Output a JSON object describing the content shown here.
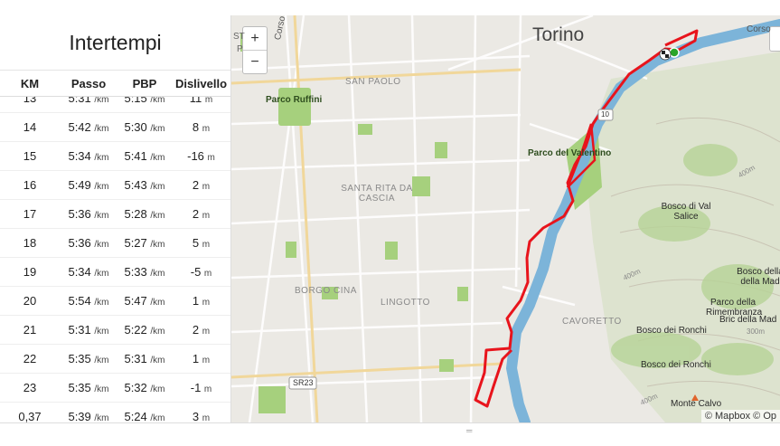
{
  "panel": {
    "title": "Intertempi",
    "columns": [
      "KM",
      "Passo",
      "PBP",
      "Dislivello"
    ],
    "rows": [
      {
        "km": "13",
        "pace": "5:31",
        "pace_unit": "/km",
        "pbp": "5:15",
        "pbp_unit": "/km",
        "elev": "11",
        "elev_unit": "m"
      },
      {
        "km": "14",
        "pace": "5:42",
        "pace_unit": "/km",
        "pbp": "5:30",
        "pbp_unit": "/km",
        "elev": "8",
        "elev_unit": "m"
      },
      {
        "km": "15",
        "pace": "5:34",
        "pace_unit": "/km",
        "pbp": "5:41",
        "pbp_unit": "/km",
        "elev": "-16",
        "elev_unit": "m"
      },
      {
        "km": "16",
        "pace": "5:49",
        "pace_unit": "/km",
        "pbp": "5:43",
        "pbp_unit": "/km",
        "elev": "2",
        "elev_unit": "m"
      },
      {
        "km": "17",
        "pace": "5:36",
        "pace_unit": "/km",
        "pbp": "5:28",
        "pbp_unit": "/km",
        "elev": "2",
        "elev_unit": "m"
      },
      {
        "km": "18",
        "pace": "5:36",
        "pace_unit": "/km",
        "pbp": "5:27",
        "pbp_unit": "/km",
        "elev": "5",
        "elev_unit": "m"
      },
      {
        "km": "19",
        "pace": "5:34",
        "pace_unit": "/km",
        "pbp": "5:33",
        "pbp_unit": "/km",
        "elev": "-5",
        "elev_unit": "m"
      },
      {
        "km": "20",
        "pace": "5:54",
        "pace_unit": "/km",
        "pbp": "5:47",
        "pbp_unit": "/km",
        "elev": "1",
        "elev_unit": "m"
      },
      {
        "km": "21",
        "pace": "5:31",
        "pace_unit": "/km",
        "pbp": "5:22",
        "pbp_unit": "/km",
        "elev": "2",
        "elev_unit": "m"
      },
      {
        "km": "22",
        "pace": "5:35",
        "pace_unit": "/km",
        "pbp": "5:31",
        "pbp_unit": "/km",
        "elev": "1",
        "elev_unit": "m"
      },
      {
        "km": "23",
        "pace": "5:35",
        "pace_unit": "/km",
        "pbp": "5:32",
        "pbp_unit": "/km",
        "elev": "-1",
        "elev_unit": "m"
      },
      {
        "km": "0,37",
        "pace": "5:39",
        "pace_unit": "/km",
        "pbp": "5:24",
        "pbp_unit": "/km",
        "elev": "3",
        "elev_unit": "m"
      }
    ]
  },
  "map": {
    "zoom_in": "+",
    "zoom_out": "−",
    "attribution": "© Mapbox © Op",
    "labels": {
      "city": "Torino",
      "parco_ruffini": "Parco Ruffini",
      "san_paolo": "SAN PAOLO",
      "santa_rita": "SANTA RITA DA CASCIA",
      "borgo_cina": "BORGO CINA",
      "lingotto": "LINGOTTO",
      "parco_valentino": "Parco del Valentino",
      "bosco_val_salice": "Bosco di Val Salice",
      "bosco_maddalena": "Bosco della della Mad",
      "parco_rimembranza": "Parco della Rimembranza",
      "bric_maddalena": "Bric della Mad",
      "bosco_ronchi_1": "Bosco dei Ronchi",
      "bosco_ronchi_2": "Bosco dei Ronchi",
      "cavoretto": "CAVORETTO",
      "monte_calvo": "Monte Calvo",
      "corso_monte": "Corso Monte",
      "corso_top": "Corso",
      "road_sr23": "SR23",
      "road_10": "10",
      "cont_400a": "400m",
      "cont_400b": "400m",
      "cont_400c": "400m",
      "cont_300": "300m",
      "label_st": "ST",
      "label_p": "P"
    },
    "colors": {
      "route": "#e8141c",
      "river": "#7cb4d9",
      "park": "#a6d07d",
      "start": "#2aa52a"
    }
  }
}
